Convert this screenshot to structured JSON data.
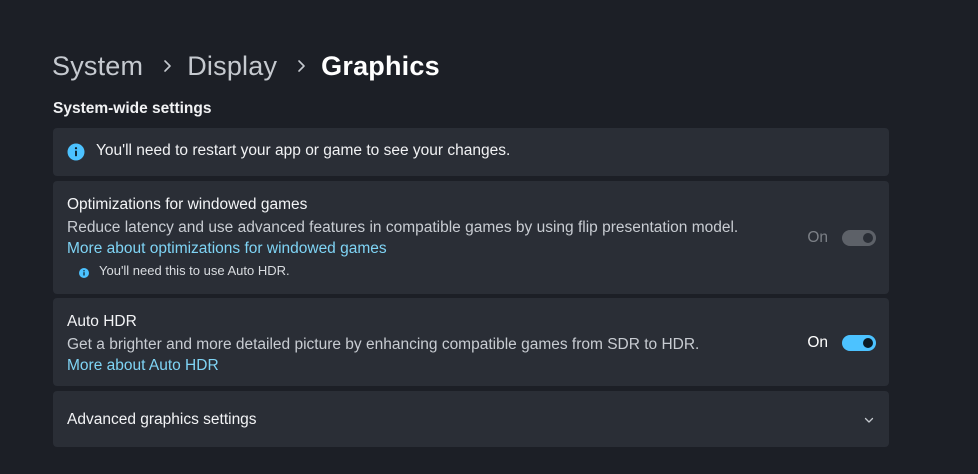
{
  "breadcrumb": {
    "items": [
      "System",
      "Display",
      "Graphics"
    ]
  },
  "section": {
    "title": "System-wide settings"
  },
  "info_banner": {
    "text": "You'll need to restart your app or game to see your changes.",
    "icon": "info-icon"
  },
  "windowed_optimizations": {
    "title": "Optimizations for windowed games",
    "description": "Reduce latency and use advanced features in compatible games by using flip presentation model.",
    "link": "More about optimizations for windowed games",
    "note": "You'll need this to use Auto HDR.",
    "toggle_label": "On",
    "toggle_state": "on-disabled"
  },
  "auto_hdr": {
    "title": "Auto HDR",
    "description": "Get a brighter and more detailed picture by enhancing compatible games from SDR to HDR.",
    "link": "More about Auto HDR",
    "toggle_label": "On",
    "toggle_state": "on"
  },
  "advanced": {
    "title": "Advanced graphics settings",
    "icon": "chevron-down-icon"
  },
  "colors": {
    "background": "#1c1f26",
    "card": "#2a2e36",
    "accent": "#4cc2ff",
    "link": "#7fd4f5"
  }
}
